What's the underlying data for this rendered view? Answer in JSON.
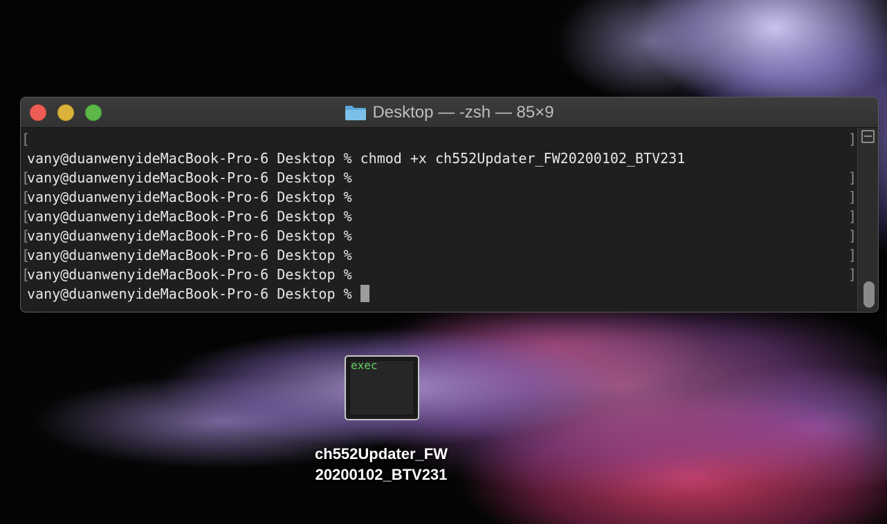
{
  "window": {
    "title": "Desktop — -zsh — 85×9",
    "folder_icon": "folder-icon",
    "controls": [
      "close-button",
      "minimize-button",
      "zoom-button"
    ]
  },
  "terminal": {
    "top_marker": "[",
    "top_marker_right": "]",
    "lines": [
      {
        "text": "vany@duanwenyideMacBook-Pro-6 Desktop % chmod +x ch552Updater_FW20200102_BTV231",
        "left_mark": "",
        "right_mark": ""
      },
      {
        "text": "vany@duanwenyideMacBook-Pro-6 Desktop %",
        "left_mark": "[",
        "right_mark": "]"
      },
      {
        "text": "vany@duanwenyideMacBook-Pro-6 Desktop %",
        "left_mark": "[",
        "right_mark": "]"
      },
      {
        "text": "vany@duanwenyideMacBook-Pro-6 Desktop %",
        "left_mark": "[",
        "right_mark": "]"
      },
      {
        "text": "vany@duanwenyideMacBook-Pro-6 Desktop %",
        "left_mark": "[",
        "right_mark": "]"
      },
      {
        "text": "vany@duanwenyideMacBook-Pro-6 Desktop %",
        "left_mark": "[",
        "right_mark": "]"
      },
      {
        "text": "vany@duanwenyideMacBook-Pro-6 Desktop %",
        "left_mark": "[",
        "right_mark": "]"
      },
      {
        "text": "vany@duanwenyideMacBook-Pro-6 Desktop % ",
        "left_mark": "",
        "right_mark": ""
      }
    ],
    "colors": {
      "background": "#1f1f1f",
      "text": "#e8e8e8",
      "cursor": "#9c9c9c"
    }
  },
  "desktop_file": {
    "icon_text": "exec",
    "label_line1": "ch552Updater_FW",
    "label_line2": "20200102_BTV231",
    "icon": "unix-executable-icon"
  }
}
